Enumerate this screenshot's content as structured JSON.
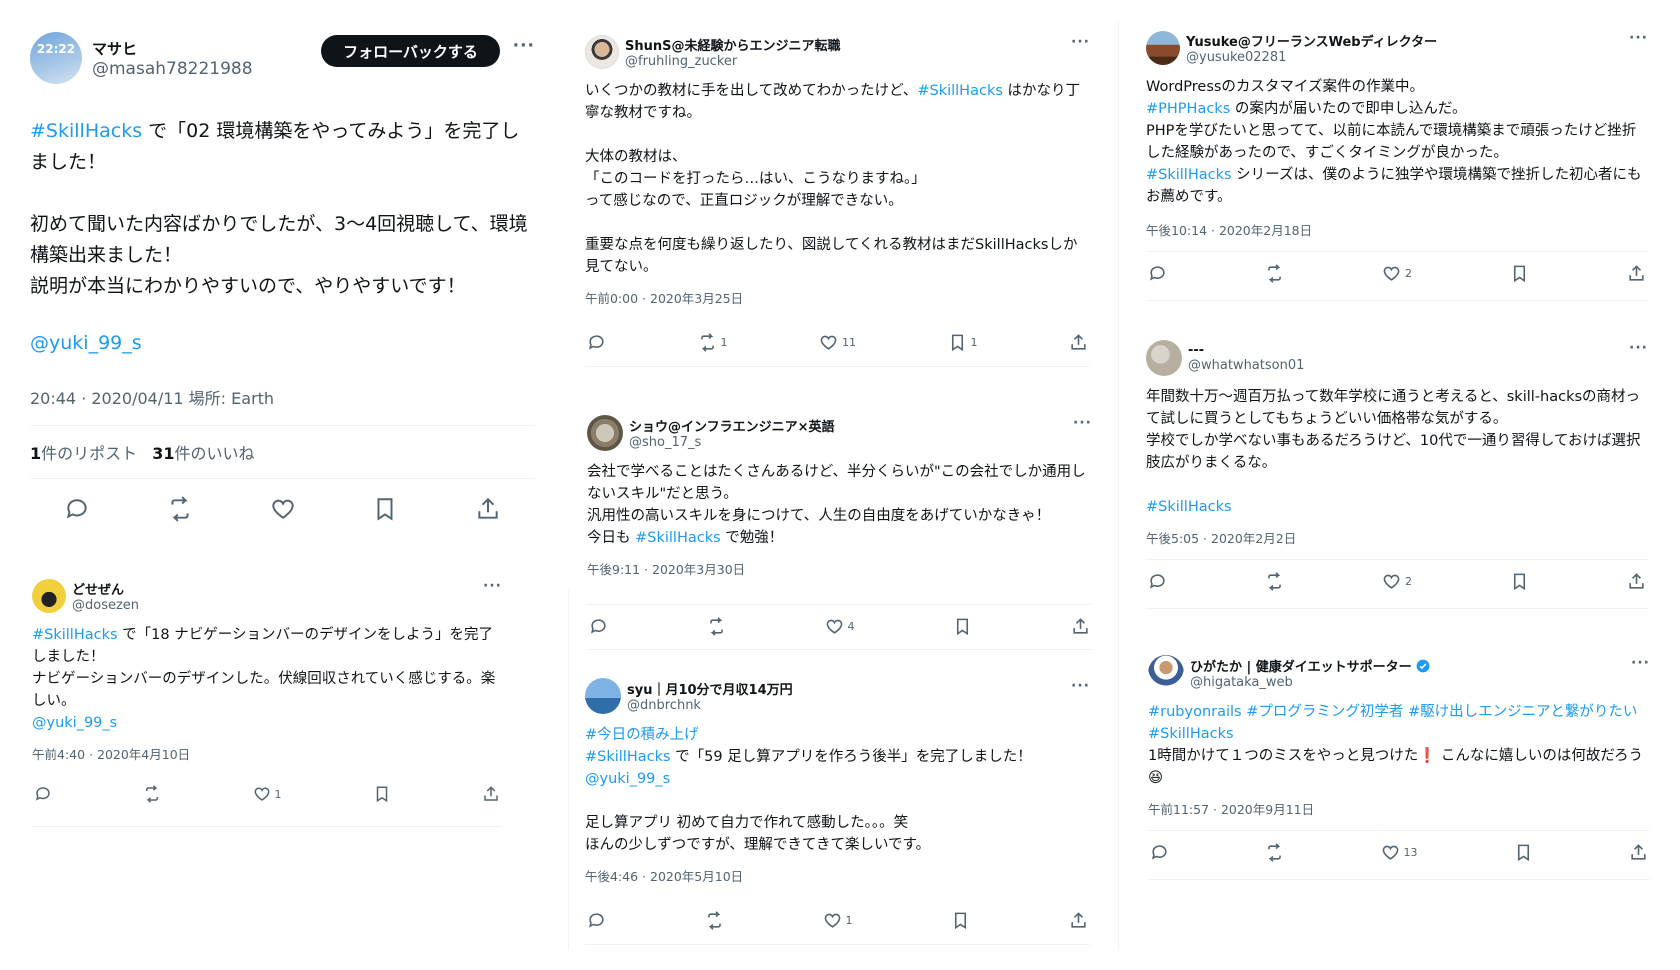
{
  "tweets": {
    "masahi": {
      "name": "マサヒ",
      "handle": "@masah78221988",
      "avatar_text": "22:22",
      "follow_label": "フォローバックする",
      "more": "···",
      "tag": "#SkillHacks",
      "text1": " で「02 環境構築をやってみよう」を完了しました！\n\n初めて聞いた内容ばかりでしたが、3〜4回視聴して、環境構築出来ました！\n説明が本当にわかりやすいので、やりやすいです！",
      "mention": "@yuki_99_s",
      "meta": "20:44 · 2020/04/11 場所: Earth",
      "reposts_count": "1",
      "reposts_label": "件のリポスト",
      "likes_count": "31",
      "likes_label": "件のいいね"
    },
    "dosezen": {
      "name": "どせぜん",
      "handle": "@dosezen",
      "more": "···",
      "tag": "#SkillHacks",
      "text1": " で「18 ナビゲーションバーのデザインをしよう」を完了しました！\nナビゲーションバーのデザインした。伏線回収されていく感じする。楽しい。",
      "mention": "@yuki_99_s",
      "meta": "午前4:40 · 2020年4月10日",
      "likes": "1"
    },
    "shuns": {
      "name": "ShunS@未経験からエンジニア転職",
      "handle": "@fruhling_zucker",
      "more": "···",
      "text1": "いくつかの教材に手を出して改めてわかったけど、",
      "tag": "#SkillHacks",
      "text2": " はかなり丁寧な教材ですね。\n\n大体の教材は、\n「このコードを打ったら…はい、こうなりますね。」\nって感じなので、正直ロジックが理解できない。\n\n重要な点を何度も繰り返したり、図説してくれる教材はまだSkillHacksしか見てない。",
      "meta": "午前0:00 · 2020年3月25日",
      "retweets": "1",
      "likes": "11",
      "bookmarks": "1"
    },
    "sho": {
      "name": "ショウ@インフラエンジニア×英語",
      "handle": "@sho_17_s",
      "more": "···",
      "text1": "会社で学べることはたくさんあるけど、半分くらいが\"この会社でしか通用しないスキル\"だと思う。\n汎用性の高いスキルを身につけて、人生の自由度をあげていかなきゃ！\n今日も ",
      "tag": "#SkillHacks",
      "text2": " で勉強！",
      "meta": "午後9:11 · 2020年3月30日",
      "likes": "4"
    },
    "syu": {
      "name": "syu｜月10分で月収14万円",
      "handle": "@dnbrchnk",
      "more": "···",
      "tag_a": "#今日の積み上げ",
      "tag_b": "#SkillHacks",
      "text1": " で「59 足し算アプリを作ろう後半」を完了しました！",
      "mention": "@yuki_99_s",
      "text2": "足し算アプリ 初めて自力で作れて感動した。。。笑\nほんの少しずつですが、理解できてきて楽しいです。",
      "meta": "午後4:46 · 2020年5月10日",
      "likes": "1"
    },
    "yusuke": {
      "name": "Yusuke@フリーランスWebディレクター",
      "handle": "@yusuke02281",
      "more": "···",
      "text1": "WordPressのカスタマイズ案件の作業中。",
      "tag_a": "#PHPHacks",
      "text2": " の案内が届いたので即申し込んだ。\nPHPを学びたいと思ってて、以前に本読んで環境構築まで頑張ったけど挫折した経験があったので、すごくタイミングが良かった。",
      "tag_b": "#SkillHacks",
      "text3": " シリーズは、僕のように独学や環境構築で挫折した初心者にもお薦めです。",
      "meta": "午後10:14 · 2020年2月18日",
      "likes": "2"
    },
    "whatwhat": {
      "name": "---",
      "handle": "@whatwhatson01",
      "more": "···",
      "text1": "年間数十万〜週百万払って数年学校に通うと考えると、skill-hacksの商材って試しに買うとしてもちょうどいい価格帯な気がする。\n学校でしか学べない事もあるだろうけど、10代で一通り習得しておけば選択肢広がりまくるな。",
      "tag": "#SkillHacks",
      "meta": "午後5:05 · 2020年2月2日",
      "likes": "2"
    },
    "higataka": {
      "name": "ひがたか | 健康ダイエットサポーター",
      "handle": "@higataka_web",
      "more": "···",
      "tags": "#rubyonrails #プログラミング初学者 #駆け出しエンジニアと繋がりたい",
      "tag": "#SkillHacks",
      "text1": "1時間かけて１つのミスをやっと見つけた",
      "exclaim": "❗",
      "text2": " こんなに嬉しいのは何故だろう",
      "emoji": "😆",
      "meta": "午前11:57 · 2020年9月11日",
      "likes": "13"
    }
  },
  "icons": [
    "reply-icon",
    "retweet-icon",
    "heart-icon",
    "bookmark-icon",
    "share-icon",
    "verified-icon"
  ],
  "colors": {
    "link": "#1d9bf0",
    "secondary": "#536471",
    "verified": "#1d9bf0",
    "button": "#0f1419"
  }
}
